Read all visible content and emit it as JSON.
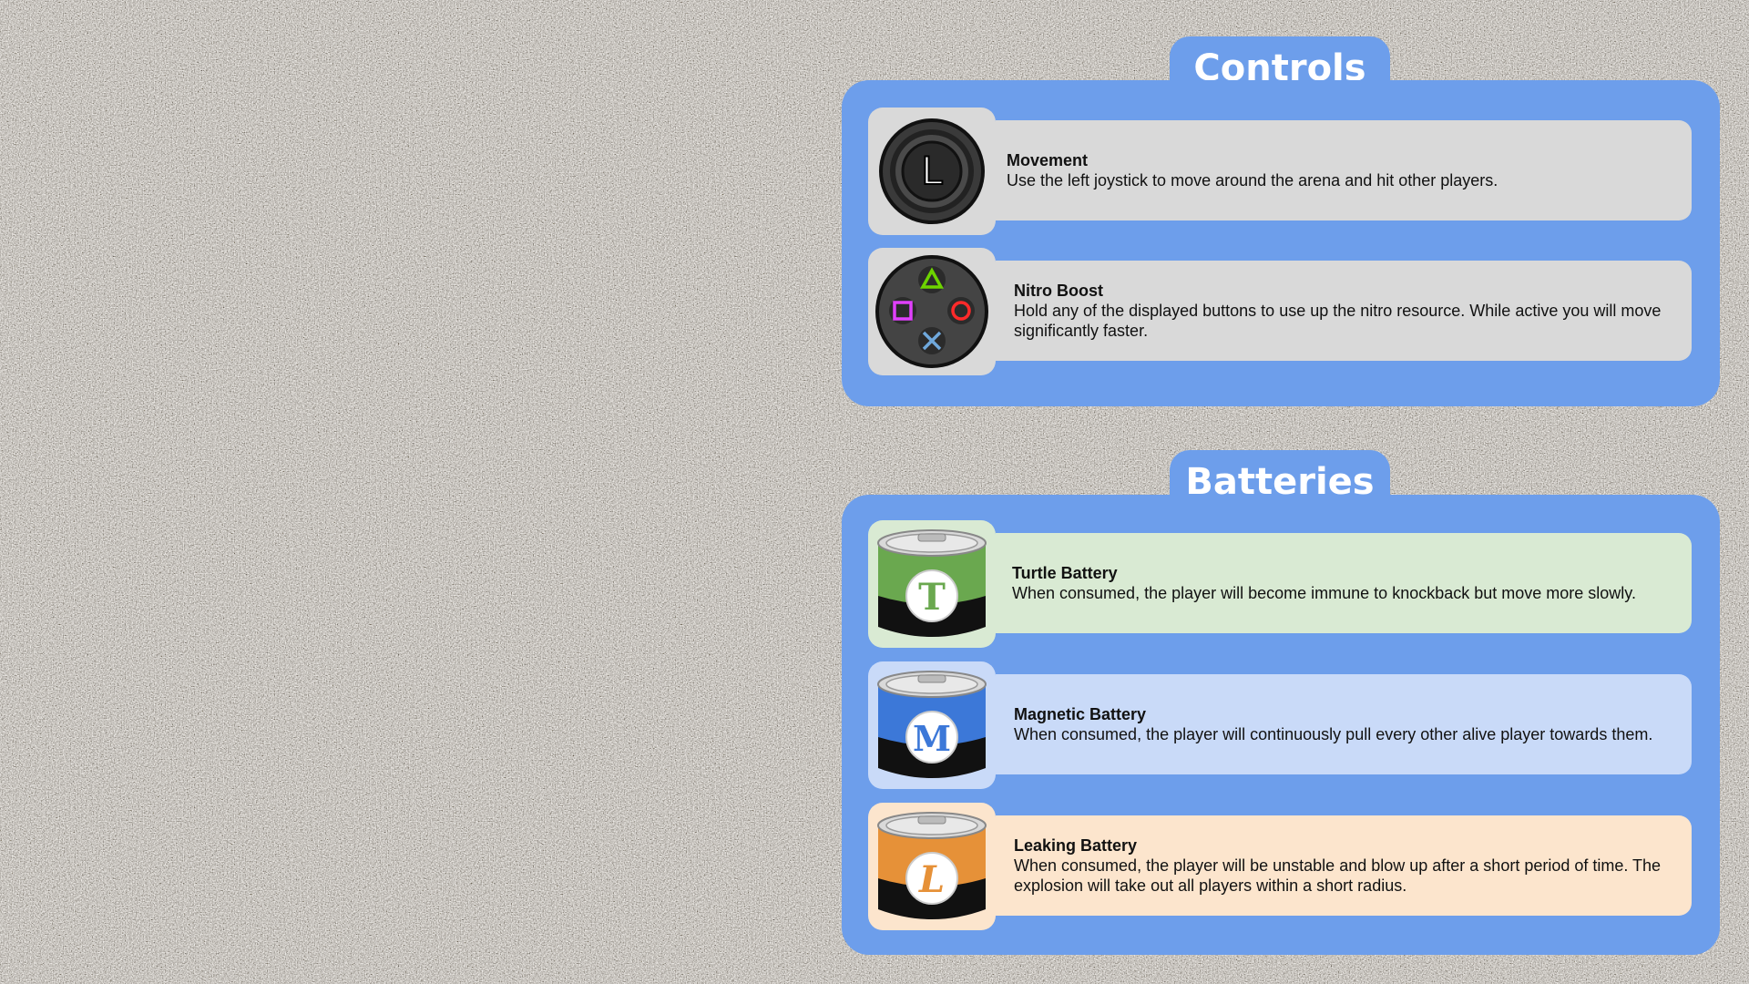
{
  "colors": {
    "panel": "#6d9eeb",
    "control_box": "#d9d9d9",
    "turtle_box": "#d9ead3",
    "magnetic_box": "#c9daf8",
    "leaking_box": "#fce5cd",
    "turtle_accent": "#6aa84f",
    "magnetic_accent": "#3c78d8",
    "leaking_accent": "#e69138"
  },
  "controls": {
    "title": "Controls",
    "items": [
      {
        "icon": "left-joystick-icon",
        "icon_letter": "L",
        "title": "Movement",
        "description": "Use the left joystick to move around the arena and hit other players."
      },
      {
        "icon": "face-buttons-icon",
        "title": "Nitro Boost",
        "description": "Hold any of the displayed buttons to use up the nitro resource. While active you will move significantly faster."
      }
    ]
  },
  "batteries": {
    "title": "Batteries",
    "items": [
      {
        "icon": "turtle-battery-icon",
        "icon_letter": "T",
        "title": "Turtle Battery",
        "description": "When consumed, the player will become immune to knockback but move more slowly."
      },
      {
        "icon": "magnetic-battery-icon",
        "icon_letter": "M",
        "title": "Magnetic Battery",
        "description": "When consumed, the player will continuously pull every other alive player towards them."
      },
      {
        "icon": "leaking-battery-icon",
        "icon_letter": "L",
        "title": "Leaking Battery",
        "description": "When consumed, the player will be unstable and blow up after a short period of time. The explosion will take out all players within a short radius."
      }
    ]
  }
}
